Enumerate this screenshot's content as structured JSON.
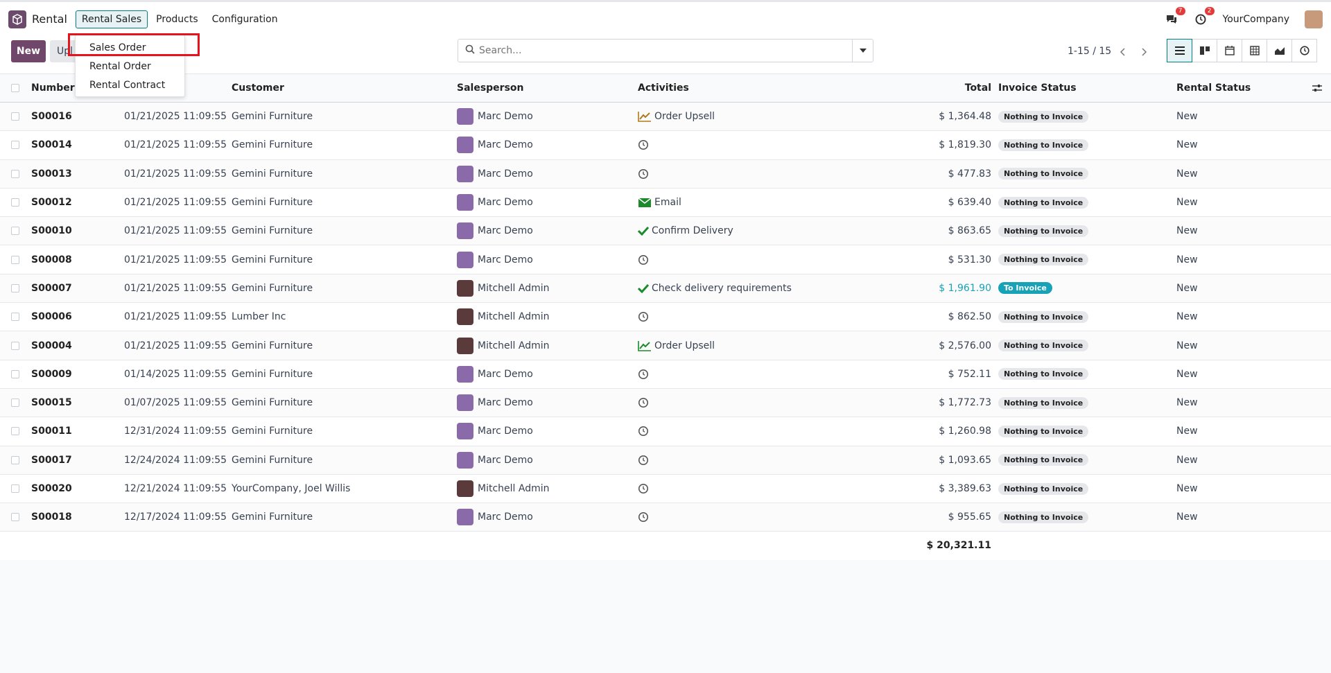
{
  "nav": {
    "app_name": "Rental",
    "menus": [
      "Rental Sales",
      "Products",
      "Configuration"
    ],
    "messages_count": "7",
    "activities_count": "2",
    "company": "YourCompany"
  },
  "dropdown": {
    "items": [
      "Sales Order",
      "Rental Order",
      "Rental Contract"
    ]
  },
  "control": {
    "new_label": "New",
    "upload_label": "Upl",
    "search_placeholder": "Search...",
    "pager": "1-15 / 15"
  },
  "table": {
    "headers": [
      "Number",
      "Customer",
      "Salesperson",
      "Activities",
      "Total",
      "Invoice Status",
      "Rental Status"
    ],
    "rows": [
      {
        "number": "S00016",
        "date": "01/21/2025 11:09:55",
        "customer": "Gemini Furniture",
        "salesperson": "Marc Demo",
        "activity": "Order Upsell",
        "activity_icon": "upsell-icon",
        "total": "$ 1,364.48",
        "invoice": "Nothing to Invoice",
        "rental": "New"
      },
      {
        "number": "S00014",
        "date": "01/21/2025 11:09:55",
        "customer": "Gemini Furniture",
        "salesperson": "Marc Demo",
        "activity": "",
        "activity_icon": "clock-icon",
        "total": "$ 1,819.30",
        "invoice": "Nothing to Invoice",
        "rental": "New"
      },
      {
        "number": "S00013",
        "date": "01/21/2025 11:09:55",
        "customer": "Gemini Furniture",
        "salesperson": "Marc Demo",
        "activity": "",
        "activity_icon": "clock-icon",
        "total": "$ 477.83",
        "invoice": "Nothing to Invoice",
        "rental": "New"
      },
      {
        "number": "S00012",
        "date": "01/21/2025 11:09:55",
        "customer": "Gemini Furniture",
        "salesperson": "Marc Demo",
        "activity": "Email",
        "activity_icon": "email-icon",
        "total": "$ 639.40",
        "invoice": "Nothing to Invoice",
        "rental": "New"
      },
      {
        "number": "S00010",
        "date": "01/21/2025 11:09:55",
        "customer": "Gemini Furniture",
        "salesperson": "Marc Demo",
        "activity": "Confirm Delivery",
        "activity_icon": "check-icon",
        "total": "$ 863.65",
        "invoice": "Nothing to Invoice",
        "rental": "New"
      },
      {
        "number": "S00008",
        "date": "01/21/2025 11:09:55",
        "customer": "Gemini Furniture",
        "salesperson": "Marc Demo",
        "activity": "",
        "activity_icon": "clock-icon",
        "total": "$ 531.30",
        "invoice": "Nothing to Invoice",
        "rental": "New"
      },
      {
        "number": "S00007",
        "date": "01/21/2025 11:09:55",
        "customer": "Gemini Furniture",
        "salesperson": "Mitchell Admin",
        "activity": "Check delivery requirements",
        "activity_icon": "check-icon",
        "total": "$ 1,961.90",
        "invoice": "To Invoice",
        "rental": "New"
      },
      {
        "number": "S00006",
        "date": "01/21/2025 11:09:55",
        "customer": "Lumber Inc",
        "salesperson": "Mitchell Admin",
        "activity": "",
        "activity_icon": "clock-icon",
        "total": "$ 862.50",
        "invoice": "Nothing to Invoice",
        "rental": "New"
      },
      {
        "number": "S00004",
        "date": "01/21/2025 11:09:55",
        "customer": "Gemini Furniture",
        "salesperson": "Mitchell Admin",
        "activity": "Order Upsell",
        "activity_icon": "upsell-green-icon",
        "total": "$ 2,576.00",
        "invoice": "Nothing to Invoice",
        "rental": "New"
      },
      {
        "number": "S00009",
        "date": "01/14/2025 11:09:55",
        "customer": "Gemini Furniture",
        "salesperson": "Marc Demo",
        "activity": "",
        "activity_icon": "clock-icon",
        "total": "$ 752.11",
        "invoice": "Nothing to Invoice",
        "rental": "New"
      },
      {
        "number": "S00015",
        "date": "01/07/2025 11:09:55",
        "customer": "Gemini Furniture",
        "salesperson": "Marc Demo",
        "activity": "",
        "activity_icon": "clock-icon",
        "total": "$ 1,772.73",
        "invoice": "Nothing to Invoice",
        "rental": "New"
      },
      {
        "number": "S00011",
        "date": "12/31/2024 11:09:55",
        "customer": "Gemini Furniture",
        "salesperson": "Marc Demo",
        "activity": "",
        "activity_icon": "clock-icon",
        "total": "$ 1,260.98",
        "invoice": "Nothing to Invoice",
        "rental": "New"
      },
      {
        "number": "S00017",
        "date": "12/24/2024 11:09:55",
        "customer": "Gemini Furniture",
        "salesperson": "Marc Demo",
        "activity": "",
        "activity_icon": "clock-icon",
        "total": "$ 1,093.65",
        "invoice": "Nothing to Invoice",
        "rental": "New"
      },
      {
        "number": "S00020",
        "date": "12/21/2024 11:09:55",
        "customer": "YourCompany, Joel Willis",
        "salesperson": "Mitchell Admin",
        "activity": "",
        "activity_icon": "clock-icon",
        "total": "$ 3,389.63",
        "invoice": "Nothing to Invoice",
        "rental": "New"
      },
      {
        "number": "S00018",
        "date": "12/17/2024 11:09:55",
        "customer": "Gemini Furniture",
        "salesperson": "Marc Demo",
        "activity": "",
        "activity_icon": "clock-icon",
        "total": "$ 955.65",
        "invoice": "Nothing to Invoice",
        "rental": "New"
      }
    ],
    "grand_total": "$ 20,321.11"
  },
  "colors": {
    "brand": "#71466b",
    "accent": "#017e84",
    "to_invoice": "#17a2b8",
    "highlight": "#e8121c"
  }
}
